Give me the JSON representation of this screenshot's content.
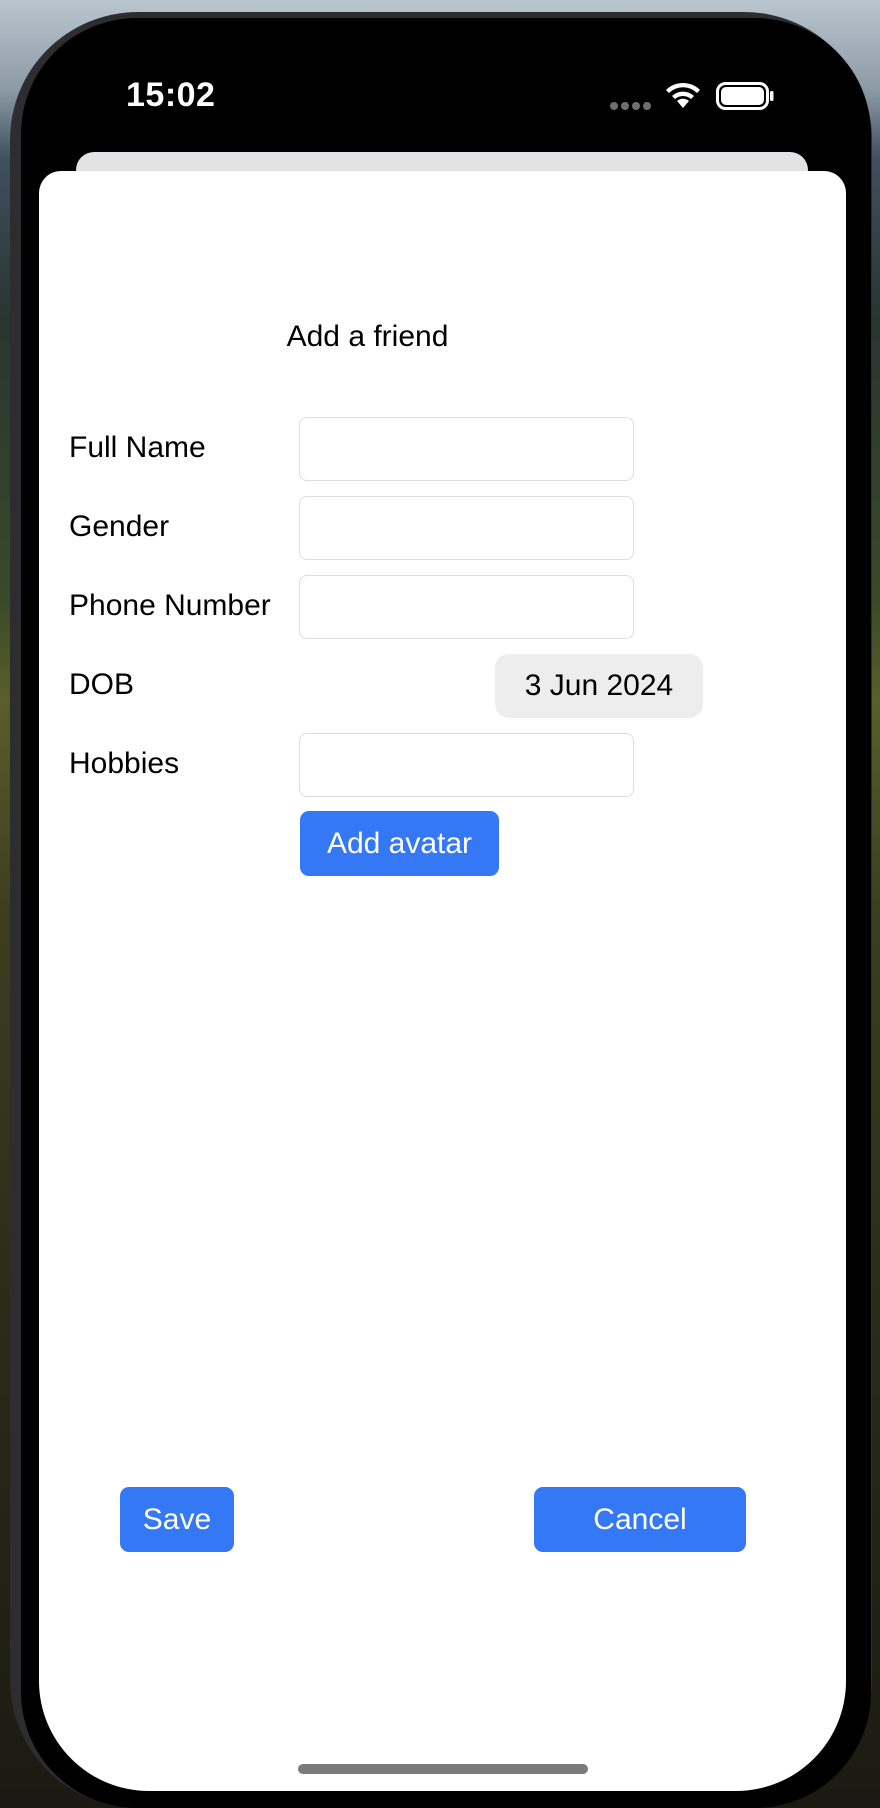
{
  "status_bar": {
    "time": "15:02"
  },
  "form": {
    "title": "Add a friend",
    "fields": [
      {
        "label": "Full Name",
        "value": ""
      },
      {
        "label": "Gender",
        "value": ""
      },
      {
        "label": "Phone Number",
        "value": ""
      },
      {
        "label": "DOB",
        "value": "3 Jun 2024"
      },
      {
        "label": "Hobbies",
        "value": ""
      }
    ],
    "add_avatar_label": "Add avatar",
    "save_label": "Save",
    "cancel_label": "Cancel"
  },
  "colors": {
    "accent": "#3478f6",
    "date_pill_bg": "#ededee"
  }
}
